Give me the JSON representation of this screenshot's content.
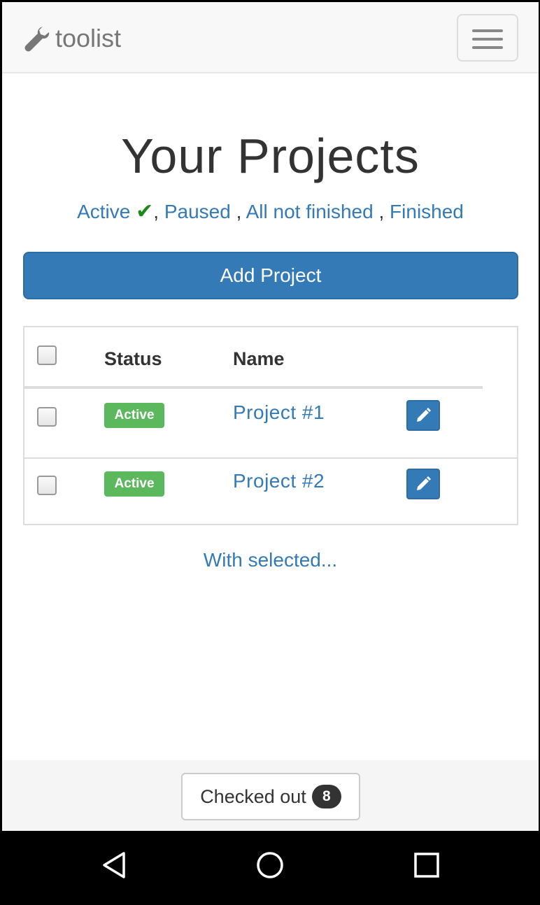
{
  "navbar": {
    "brand": "toolist",
    "brand_icon": "wrench-icon",
    "menu_icon": "hamburger-menu-icon"
  },
  "page": {
    "title": "Your Projects",
    "filters": [
      {
        "label": "Active",
        "selected": true
      },
      {
        "label": "Paused",
        "selected": false
      },
      {
        "label": "All not finished",
        "selected": false
      },
      {
        "label": "Finished",
        "selected": false
      }
    ],
    "separator": ",",
    "add_button": "Add Project"
  },
  "table": {
    "headers": {
      "status": "Status",
      "name": "Name"
    },
    "rows": [
      {
        "status": "Active",
        "name": "Project #1"
      },
      {
        "status": "Active",
        "name": "Project #2"
      }
    ]
  },
  "with_selected": "With selected...",
  "footer": {
    "checked_out_label": "Checked out",
    "checked_out_count": "8"
  },
  "colors": {
    "primary": "#337ab7",
    "success": "#5cb85c",
    "check": "#1d8a1d"
  }
}
